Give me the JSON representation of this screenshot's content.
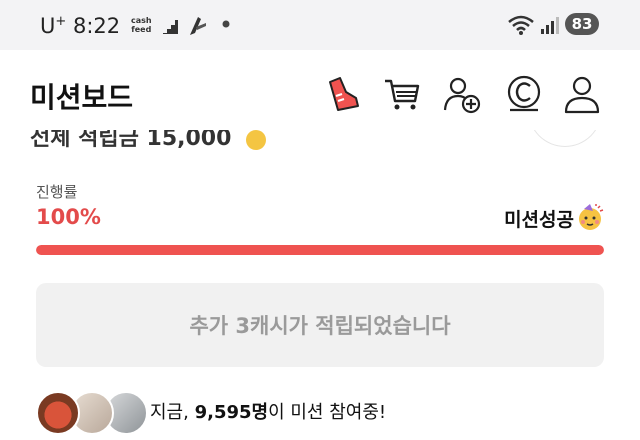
{
  "status_bar": {
    "carrier": "U",
    "carrier_sup": "+",
    "time": "8:22",
    "cashfeed_line1": "cash",
    "cashfeed_line2": "feed",
    "battery": "83"
  },
  "header": {
    "title": "미션보드",
    "icons": [
      "shoe-icon",
      "cart-icon",
      "add-user-icon",
      "cash-coin-icon",
      "profile-icon"
    ]
  },
  "partial_row": {
    "text": "전체 적립금 15,000"
  },
  "progress": {
    "label": "진행률",
    "value_text": "100%",
    "fraction": 1.0,
    "status": "미션성공"
  },
  "reward": {
    "message": "추가 3캐시가 적립되었습니다"
  },
  "participants": {
    "prefix": "지금, ",
    "count": "9,595명",
    "suffix": "이 미션 참여중!"
  },
  "colors": {
    "accent": "#ef5350",
    "percent_text": "#e34b4b",
    "status_bar_bg": "#f3f3f5",
    "reward_bg": "#f1f1f1"
  }
}
